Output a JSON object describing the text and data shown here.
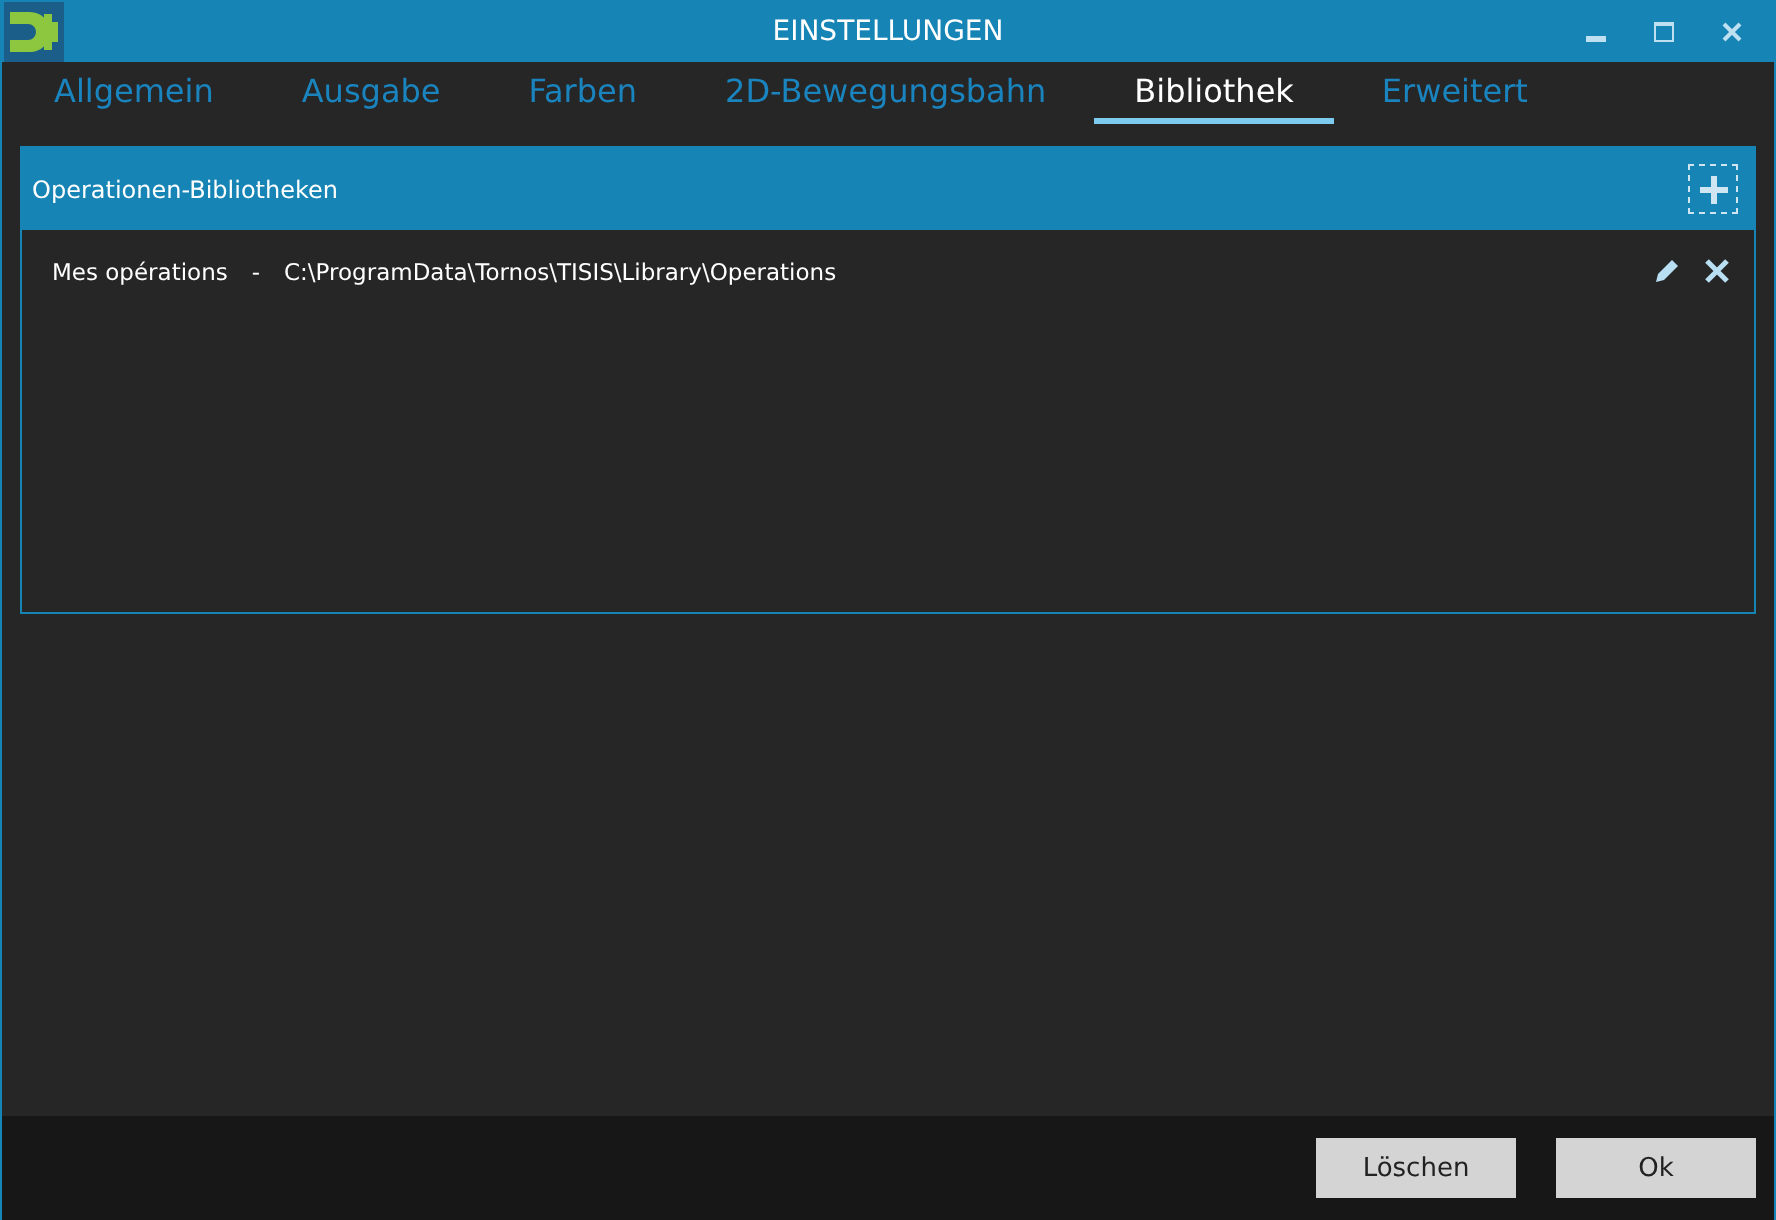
{
  "window": {
    "title": "EINSTELLUNGEN"
  },
  "tabs": [
    {
      "label": "Allgemein",
      "selected": false
    },
    {
      "label": "Ausgabe",
      "selected": false
    },
    {
      "label": "Farben",
      "selected": false
    },
    {
      "label": "2D-Bewegungsbahn",
      "selected": false
    },
    {
      "label": "Bibliothek",
      "selected": true
    },
    {
      "label": "Erweitert",
      "selected": false
    }
  ],
  "panel": {
    "title": "Operationen-Bibliotheken",
    "libraries": [
      {
        "name": "Mes opérations",
        "separator": "-",
        "path": "C:\\ProgramData\\Tornos\\TISIS\\Library\\Operations"
      }
    ]
  },
  "buttons": [
    "Löschen",
    "Ok"
  ]
}
